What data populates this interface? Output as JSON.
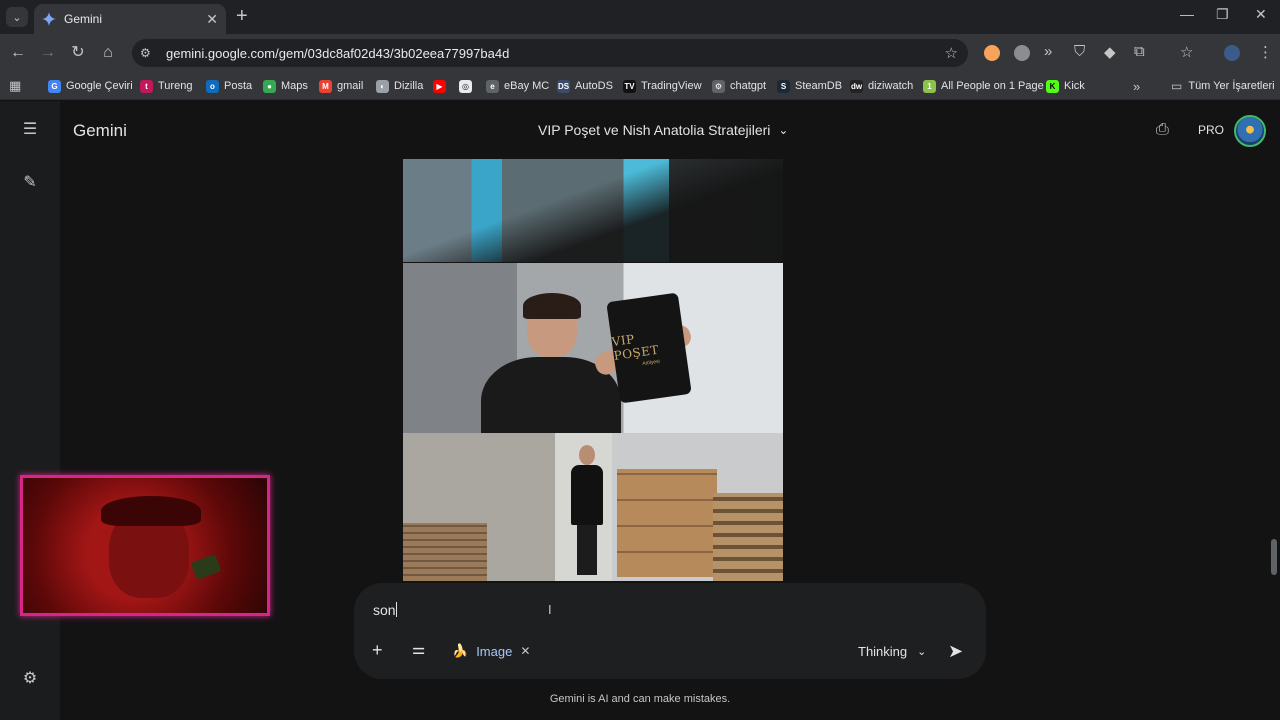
{
  "browser": {
    "tab": {
      "title": "Gemini"
    },
    "url": "gemini.google.com/gem/03dc8af02d43/3b02eea77997ba4d"
  },
  "bookmarks": [
    {
      "label": "Google Çeviri",
      "color": "#4285f4",
      "glyph": "G"
    },
    {
      "label": "Tureng",
      "color": "#c2185b",
      "glyph": "t"
    },
    {
      "label": "Posta",
      "color": "#0f6cbd",
      "glyph": "o"
    },
    {
      "label": "Maps",
      "color": "#34a853",
      "glyph": "●"
    },
    {
      "label": "gmail",
      "color": "#ea4335",
      "glyph": "M"
    },
    {
      "label": "Dizilla",
      "color": "#9aa0a6",
      "glyph": "◐"
    },
    {
      "label": "",
      "color": "#ff0000",
      "glyph": "▶"
    },
    {
      "label": "",
      "color": "#e8eaed",
      "glyph": "◎"
    },
    {
      "label": "eBay MC",
      "color": "#5f6368",
      "glyph": "e"
    },
    {
      "label": "AutoDS",
      "color": "#3c4a6b",
      "glyph": "DS"
    },
    {
      "label": "TradingView",
      "color": "#111",
      "glyph": "TV"
    },
    {
      "label": "chatgpt",
      "color": "#5f6368",
      "glyph": "⚙"
    },
    {
      "label": "SteamDB",
      "color": "#1b2838",
      "glyph": "S"
    },
    {
      "label": "diziwatch",
      "color": "#222",
      "glyph": "dw"
    },
    {
      "label": "All People on 1 Page",
      "color": "#8bc34a",
      "glyph": "1"
    },
    {
      "label": "Kick",
      "color": "#53fc18",
      "glyph": "K"
    }
  ],
  "bookmarks_folder": "Tüm Yer İşaretleri",
  "app": {
    "brand": "Gemini",
    "conversation_title": "VIP Poşet ve Nish Anatolia Stratejileri",
    "plan_badge": "PRO"
  },
  "image_content": {
    "bag_text": "VIP POŞET",
    "bag_subtext": "Atölyesi"
  },
  "composer": {
    "typed_text": "son",
    "tool_chip_label": "Image",
    "mode_label": "Thinking"
  },
  "disclaimer": "Gemini is AI and can make mistakes.",
  "colors": {
    "background": "#131314",
    "chip_text": "#a8c7fa",
    "webcam_border": "#d6268a"
  }
}
